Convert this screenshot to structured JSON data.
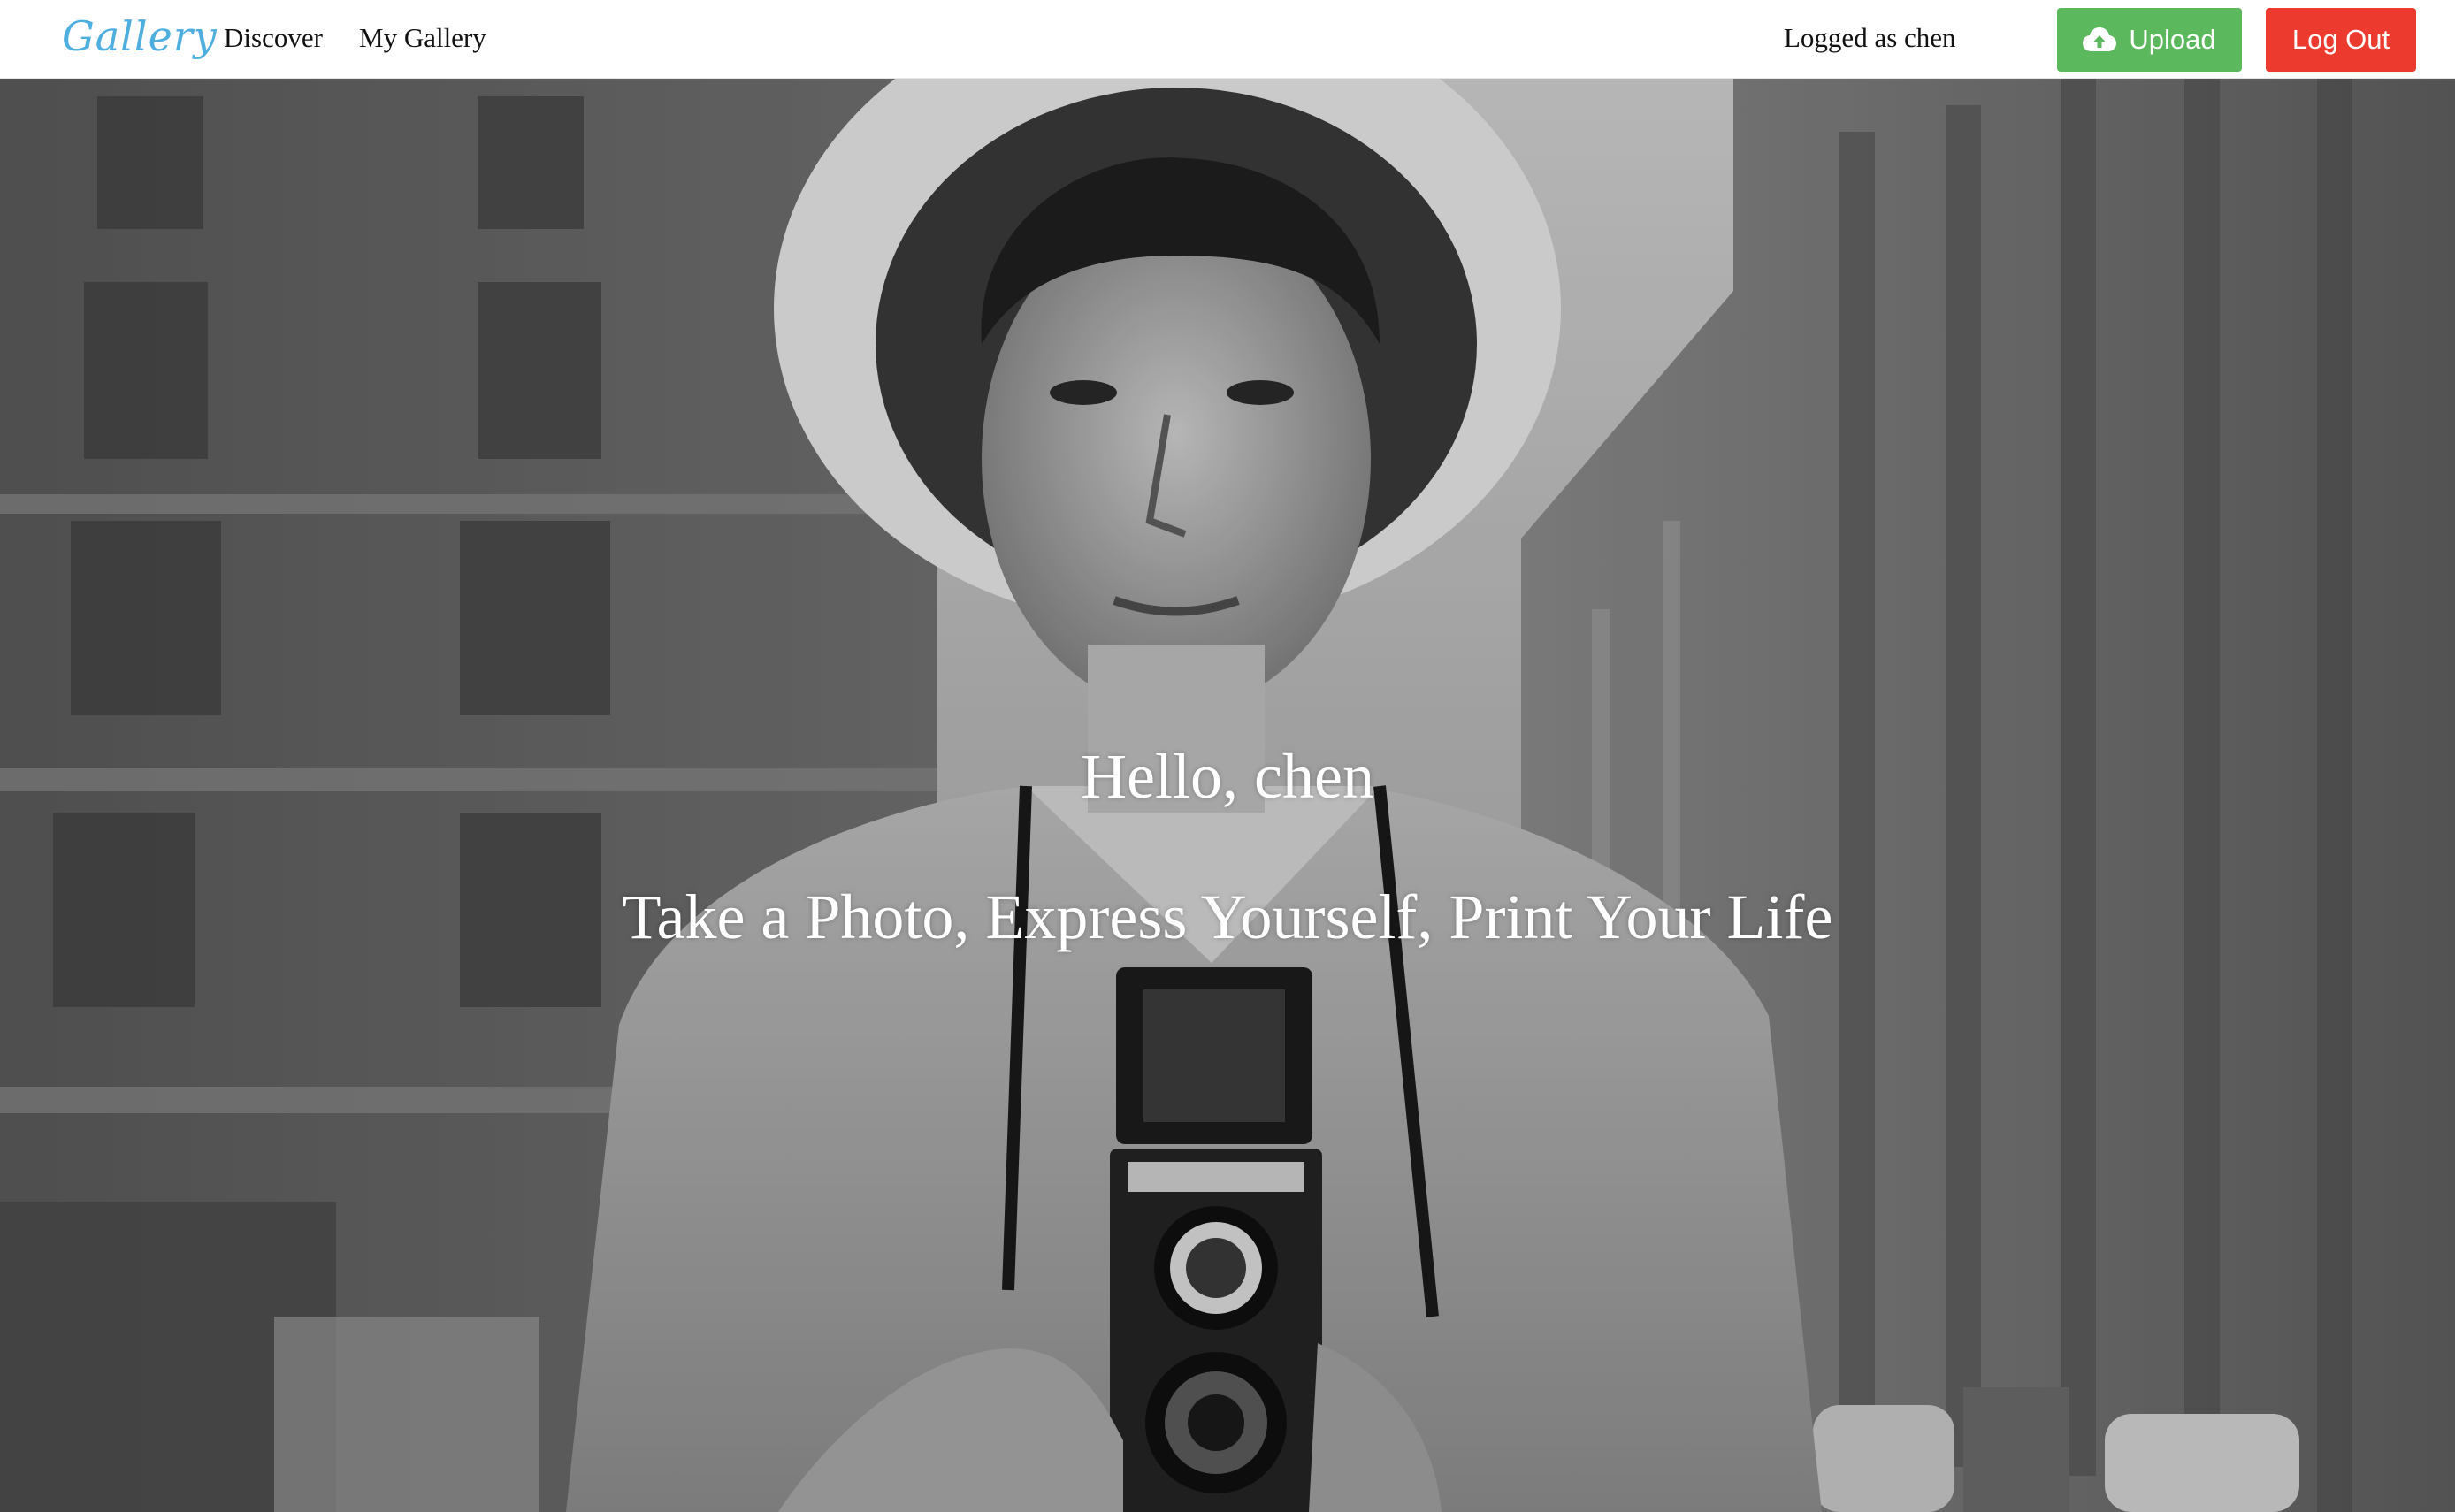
{
  "navbar": {
    "brand": "Gallery",
    "links": [
      "Discover",
      "My Gallery"
    ],
    "logged_as": "Logged as chen",
    "upload_label": "Upload",
    "upload_icon": "cloud-upload-icon",
    "logout_label": "Log Out"
  },
  "hero": {
    "greeting": "Hello, chen",
    "tagline": "Take a Photo, Express Yourself, Print Your Life"
  },
  "colors": {
    "brand": "#4eaee0",
    "upload": "#5cb85c",
    "logout": "#ec3a2e"
  }
}
